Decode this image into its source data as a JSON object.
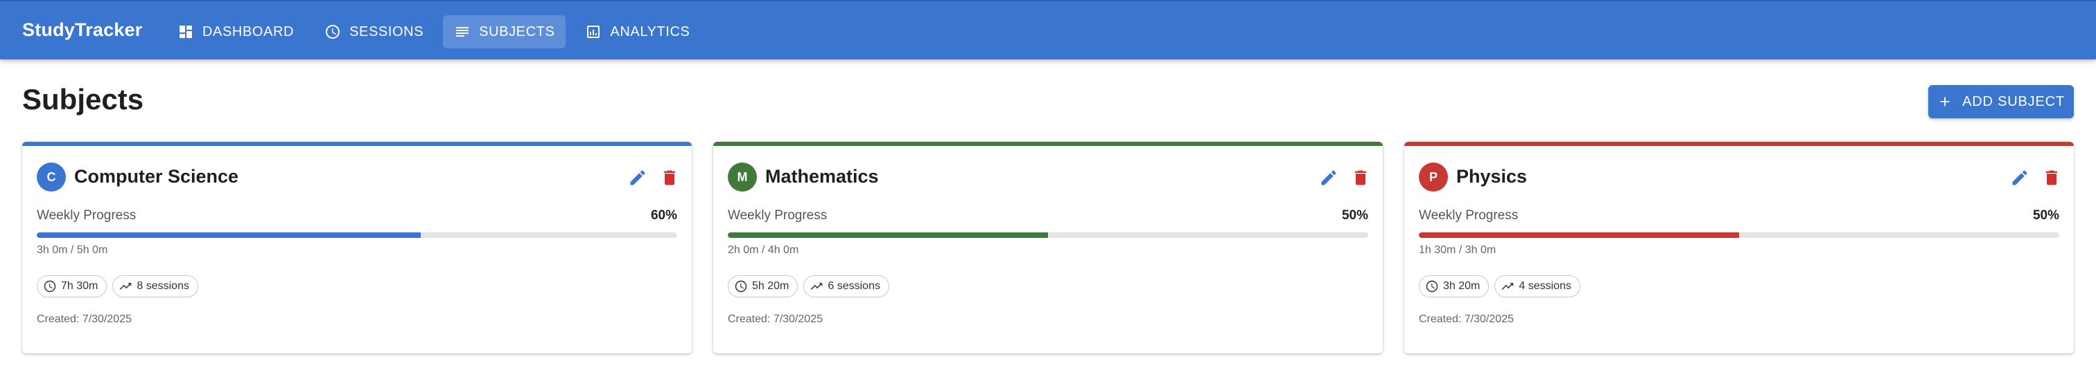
{
  "app": {
    "brand": "StudyTracker"
  },
  "nav": [
    {
      "label": "DASHBOARD",
      "icon": "dashboard-icon"
    },
    {
      "label": "SESSIONS",
      "icon": "clock-icon"
    },
    {
      "label": "SUBJECTS",
      "icon": "list-icon",
      "active": true
    },
    {
      "label": "ANALYTICS",
      "icon": "analytics-icon"
    }
  ],
  "page": {
    "title": "Subjects",
    "add_button_label": "ADD SUBJECT"
  },
  "labels": {
    "weekly_progress": "Weekly Progress"
  },
  "subjects": [
    {
      "initial": "C",
      "name": "Computer Science",
      "color": "#3a76cf",
      "progress_percent": 60,
      "progress_text": "60%",
      "time_text": "3h 0m / 5h 0m",
      "total_time": "7h 30m",
      "sessions": "8 sessions",
      "created": "Created: 7/30/2025"
    },
    {
      "initial": "M",
      "name": "Mathematics",
      "color": "#3f7a3a",
      "progress_percent": 50,
      "progress_text": "50%",
      "time_text": "2h 0m / 4h 0m",
      "total_time": "5h 20m",
      "sessions": "6 sessions",
      "created": "Created: 7/30/2025"
    },
    {
      "initial": "P",
      "name": "Physics",
      "color": "#c73a33",
      "progress_percent": 50,
      "progress_text": "50%",
      "time_text": "1h 30m / 3h 0m",
      "total_time": "3h 20m",
      "sessions": "4 sessions",
      "created": "Created: 7/30/2025"
    }
  ]
}
